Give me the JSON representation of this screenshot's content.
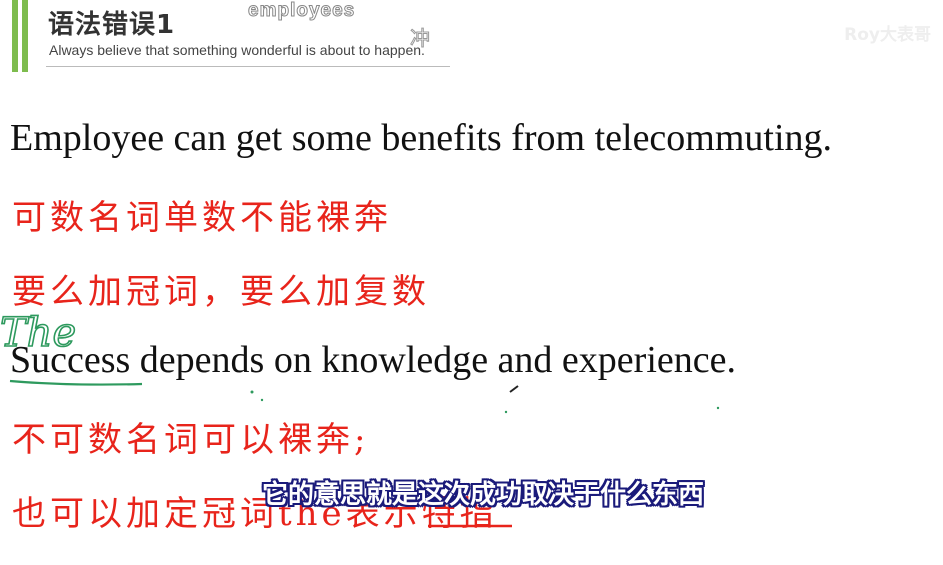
{
  "header": {
    "title": "语法错误1",
    "subtitle": "Always believe that something wonderful is about to happen.",
    "watermark_word": "employees",
    "watermark_char": "冲",
    "brand": "Roy大表哥"
  },
  "lines": {
    "sentence1": "Employee can get some benefits from telecommuting.",
    "note1": "可数名词单数不能裸奔",
    "note2": "要么加冠词，要么加复数",
    "sentence2": "Success depends on knowledge and experience.",
    "note3": "不可数名词可以裸奔;",
    "note4": "也可以加定冠词the表示特指"
  },
  "handwriting": {
    "annotation": "The"
  },
  "caption": {
    "text": "它的意思就是这次成功取决于什么东西"
  },
  "colors": {
    "accent_bar": "#7ebc4e",
    "note_red": "#e8241b",
    "ink_green": "#2e9a5e"
  }
}
